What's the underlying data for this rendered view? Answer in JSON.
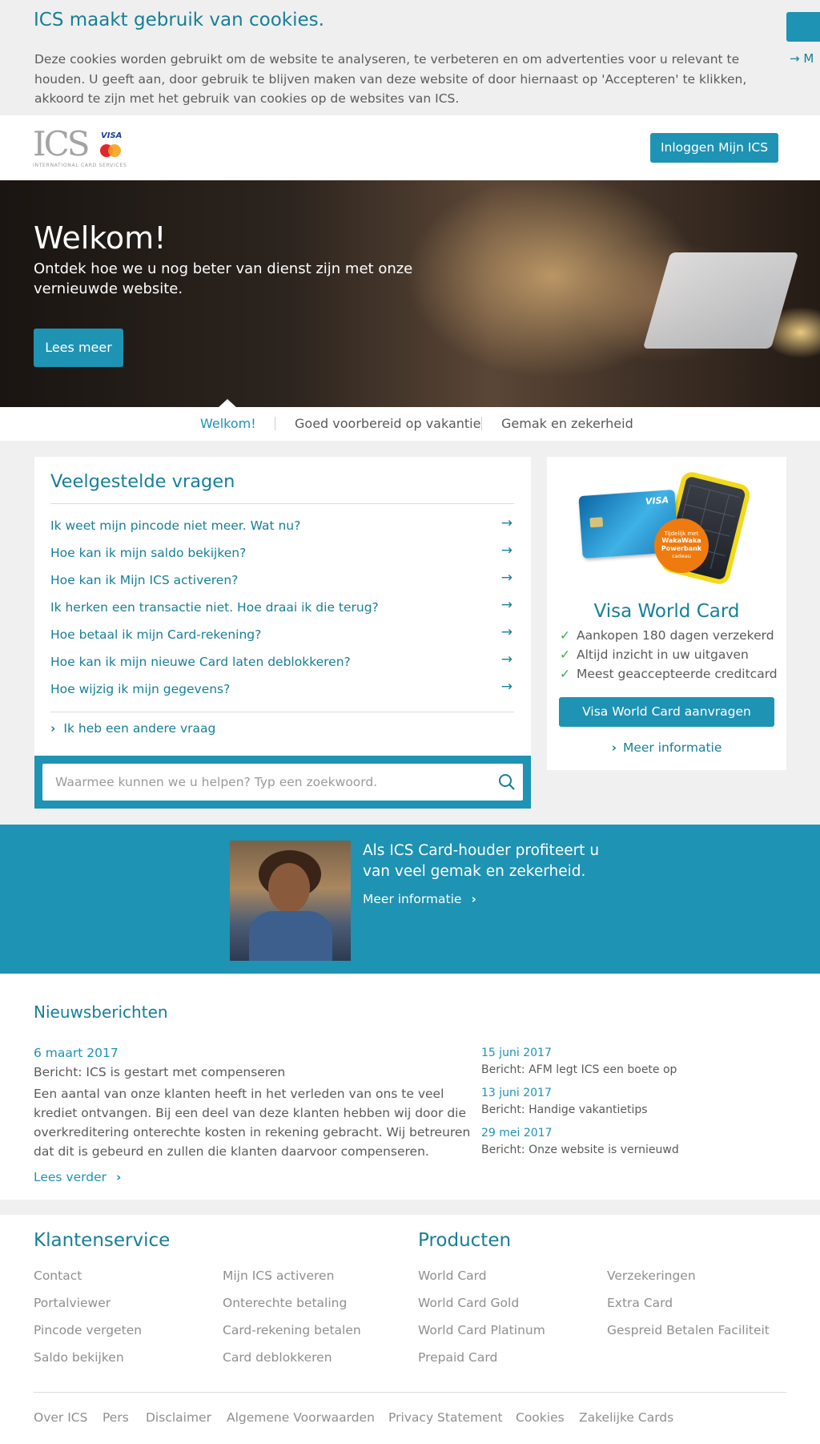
{
  "cookie": {
    "title": "ICS maakt gebruik van cookies.",
    "text": "Deze cookies worden gebruikt om de website te analyseren, te verbeteren en om advertenties voor u relevant te houden. U geeft aan, door gebruik te blijven maken van deze website of door hiernaast op 'Accepteren' te klikken, akkoord te zijn met het gebruik van cookies op de websites van ICS.",
    "more_link": "→ M"
  },
  "header": {
    "logo_text": "ICS",
    "logo_sub": "INTERNATIONAL CARD SERVICES",
    "logo_visa": "VISA",
    "login_label": "Inloggen Mijn ICS"
  },
  "hero": {
    "title": "Welkom!",
    "subtitle": "Ontdek hoe we u nog beter van dienst zijn met onze vernieuwde website.",
    "button_label": "Lees meer"
  },
  "tabs": [
    {
      "label": "Welkom!"
    },
    {
      "label": "Goed voorbereid op vakantie"
    },
    {
      "label": "Gemak en zekerheid"
    }
  ],
  "faq": {
    "title": "Veelgestelde vragen",
    "items": [
      {
        "label": "Ik weet mijn pincode niet meer. Wat nu?"
      },
      {
        "label": "Hoe kan ik mijn saldo bekijken?"
      },
      {
        "label": "Hoe kan ik Mijn ICS activeren?"
      },
      {
        "label": "Ik herken een transactie niet. Hoe draai ik die terug?"
      },
      {
        "label": "Hoe betaal ik mijn Card-rekening?"
      },
      {
        "label": "Hoe kan ik mijn nieuwe Card laten deblokkeren?"
      },
      {
        "label": "Hoe wijzig ik mijn gegevens?"
      }
    ],
    "other_label": "Ik heb een andere vraag",
    "search_placeholder": "Waarmee kunnen we u helpen? Typ een zoekwoord."
  },
  "promo": {
    "card_visa": "VISA",
    "badge_line1": "Tijdelijk met",
    "badge_line2": "WakaWaka Powerbank",
    "badge_line3": "cadeau",
    "title": "Visa World Card",
    "checks": [
      {
        "label": "Aankopen 180 dagen verzekerd"
      },
      {
        "label": "Altijd inzicht in uw uitgaven"
      },
      {
        "label": "Meest geaccepteerde creditcard"
      }
    ],
    "button_label": "Visa World Card aanvragen",
    "more_label": "Meer informatie"
  },
  "holder": {
    "text": "Als ICS Card-houder profiteert u van veel gemak en zekerheid.",
    "more_label": "Meer informatie"
  },
  "news": {
    "title": "Nieuwsberichten",
    "main": {
      "date": "6 maart 2017",
      "headline": "Bericht: ICS is gestart met compenseren",
      "body": "Een aantal van onze klanten heeft in het verleden van ons te veel krediet ontvangen. Bij een deel van deze klanten hebben wij door die overkreditering onterechte kosten in rekening gebracht. Wij betreuren dat dit is gebeurd en zullen die klanten daarvoor compenseren.",
      "read_more": "Lees verder"
    },
    "side": [
      {
        "date": "15 juni 2017",
        "headline": "Bericht: AFM legt ICS een boete op"
      },
      {
        "date": "13 juni 2017",
        "headline": "Bericht: Handige vakantietips"
      },
      {
        "date": "29 mei 2017",
        "headline": "Bericht: Onze website is vernieuwd"
      }
    ]
  },
  "footer": {
    "service_title": "Klantenservice",
    "service_col1": [
      "Contact",
      "Portalviewer",
      "Pincode vergeten",
      "Saldo bekijken"
    ],
    "service_col2": [
      "Mijn ICS activeren",
      "Onterechte betaling",
      "Card-rekening betalen",
      "Card deblokkeren"
    ],
    "products_title": "Producten",
    "products_col1": [
      "World Card",
      "World Card Gold",
      "World Card Platinum",
      "Prepaid Card"
    ],
    "products_col2": [
      "Verzekeringen",
      "Extra Card",
      "Gespreid Betalen Faciliteit"
    ],
    "bottom_links": [
      "Over ICS",
      "Pers",
      "Disclaimer",
      "Algemene Voorwaarden",
      "Privacy Statement",
      "Cookies",
      "Zakelijke Cards"
    ]
  }
}
